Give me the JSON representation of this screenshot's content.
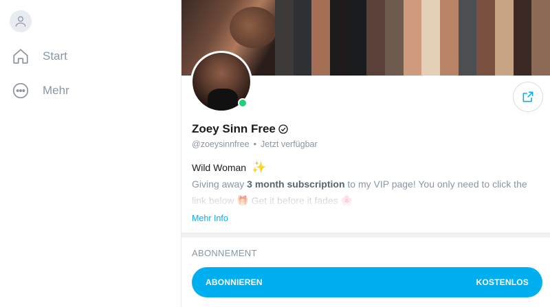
{
  "nav": {
    "items": [
      {
        "label": "Start",
        "icon": "home-icon"
      },
      {
        "label": "Mehr",
        "icon": "more-icon"
      }
    ]
  },
  "profile": {
    "name": "Zoey Sinn Free",
    "handle": "@zoeysinnfree",
    "separator": "•",
    "status": "Jetzt verfügbar",
    "bio_title": "Wild Woman",
    "bio_title_emoji": "✨",
    "bio_text_pre": "Giving away ",
    "bio_text_bold": "3 month subscription",
    "bio_text_post": " to my VIP page! You only need to click the link below 🎁 Get it before it fades 🌸",
    "more_info": "Mehr Info"
  },
  "subscription": {
    "section_title": "ABONNEMENT",
    "button_label": "ABONNIEREN",
    "price_label": "KOSTENLOS"
  },
  "colors": {
    "accent": "#00aff0",
    "online": "#21d17a",
    "muted": "#8a96a3"
  }
}
